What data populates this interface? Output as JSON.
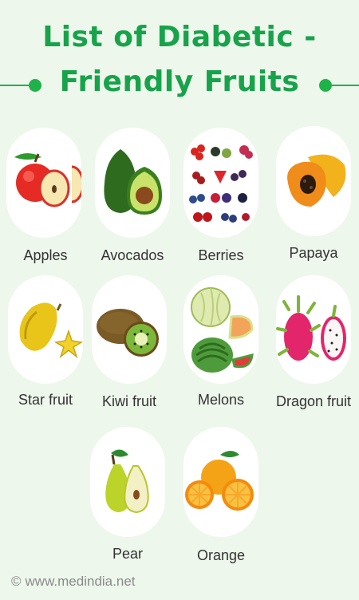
{
  "title": {
    "line1": "List of Diabetic -",
    "line2": "Friendly Fruits"
  },
  "fruits": [
    {
      "label": "Apples",
      "icon": "apple-icon"
    },
    {
      "label": "Avocados",
      "icon": "avocado-icon"
    },
    {
      "label": "Berries",
      "icon": "berries-icon"
    },
    {
      "label": "Papaya",
      "icon": "papaya-icon"
    },
    {
      "label": "Star fruit",
      "icon": "star-fruit-icon"
    },
    {
      "label": "Kiwi fruit",
      "icon": "kiwi-icon"
    },
    {
      "label": "Melons",
      "icon": "melon-icon"
    },
    {
      "label": "Dragon fruit",
      "icon": "dragon-fruit-icon"
    },
    {
      "label": "Pear",
      "icon": "pear-icon"
    },
    {
      "label": "Orange",
      "icon": "orange-icon"
    }
  ],
  "footer": {
    "copyright_symbol": "©",
    "site": "www.medindia.net"
  },
  "colors": {
    "background": "#eef7ec",
    "title": "#17a34a",
    "accent": "#1fb24a"
  }
}
